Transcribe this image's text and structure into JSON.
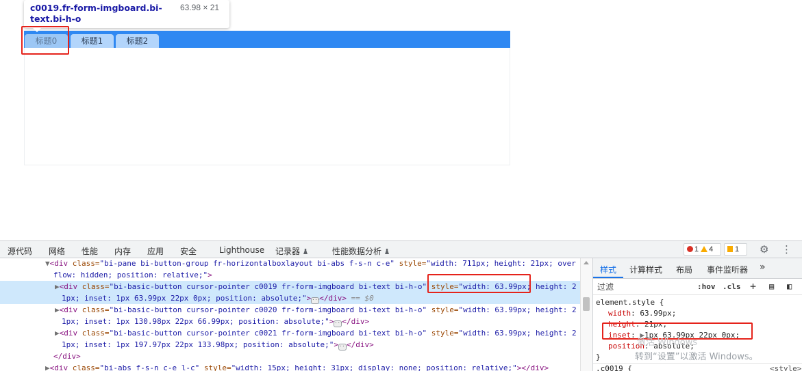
{
  "preview": {
    "tooltip": {
      "selector": "c0019.fr-form-imgboard.bi-text.bi-h-o",
      "dimensions": "63.98 × 21"
    },
    "tabs": [
      {
        "label": "标题0",
        "active": true
      },
      {
        "label": "标题1",
        "active": false
      },
      {
        "label": "标题2",
        "active": false
      }
    ],
    "colors": {
      "tab_bar": "#2f88f2",
      "tab": "#b3d5fb",
      "highlight_box": "#e5231b"
    }
  },
  "devtools": {
    "tabs": [
      "源代码",
      "网络",
      "性能",
      "内存",
      "应用",
      "安全",
      "Lighthouse",
      "记录器",
      "性能数据分析"
    ],
    "error_count": "1",
    "warning_count": "4",
    "issue_count": "1",
    "elements": {
      "line1": {
        "open": "<div ",
        "class_attr": "class=",
        "class_val": "\"bi-pane bi-button-group fr-horizontalboxlayout bi-abs f-s-n c-e\"",
        "style_attr": " style=",
        "style_val": "\"width: 711px; height: 21px; over",
        "cont": "flow: hidden; position: relative;\"",
        "close": ">"
      },
      "line2": {
        "open": "<div ",
        "class_attr": "class=",
        "class_val": "\"bi-basic-button cursor-pointer c0019 fr-form-imgboard bi-text bi-h-o\"",
        "style_attr": " style=",
        "style_val": "\"width: 63.99px; height: 2",
        "cont": "1px; inset: 1px 63.99px 22px 0px; position: absolute;\"",
        "close": "</div>",
        "suffix": " == $0"
      },
      "line3": {
        "open": "<div ",
        "class_attr": "class=",
        "class_val": "\"bi-basic-button cursor-pointer c0020 fr-form-imgboard bi-text bi-h-o\"",
        "style_attr": " style=",
        "style_val": "\"width: 63.99px; height: 2",
        "cont": "1px; inset: 1px 130.98px 22px 66.99px; position: absolute;\"",
        "close": "</div>"
      },
      "line4": {
        "open": "<div ",
        "class_attr": "class=",
        "class_val": "\"bi-basic-button cursor-pointer c0021 fr-form-imgboard bi-text bi-h-o\"",
        "style_attr": " style=",
        "style_val": "\"width: 63.99px; height: 2",
        "cont": "1px; inset: 1px 197.97px 22px 133.98px; position: absolute;\"",
        "close": "</div>"
      },
      "closing_div": "</div>",
      "line5": {
        "open": "<div ",
        "class_attr": "class=",
        "class_val": "\"bi-abs f-s-n c-e l-c\"",
        "style_attr": " style=",
        "style_val": "\"width: 15px; height: 31px; display: none; position: relative;\"",
        "close": "></div>"
      }
    },
    "styles_panel": {
      "tabs": [
        "样式",
        "计算样式",
        "布局",
        "事件监听器"
      ],
      "more": "»",
      "filter_placeholder": "过滤",
      "hov": ":hov",
      ".cls": ".cls",
      "plus": "+",
      "rule_selector": "element.style {",
      "properties": [
        {
          "name": "width",
          "value": "63.99px;"
        },
        {
          "name": "height",
          "value": "21px;"
        },
        {
          "name": "inset",
          "value": "1px 63.99px 22px 0px;"
        },
        {
          "name": "position",
          "value": "absolute;"
        }
      ],
      "rule_close": "}",
      "next_selector": ".c0019 {",
      "next_source": "<style>"
    },
    "watermark": {
      "line1": "激活 Windows",
      "line2": "转到“设置”以激活 Windows。"
    }
  }
}
